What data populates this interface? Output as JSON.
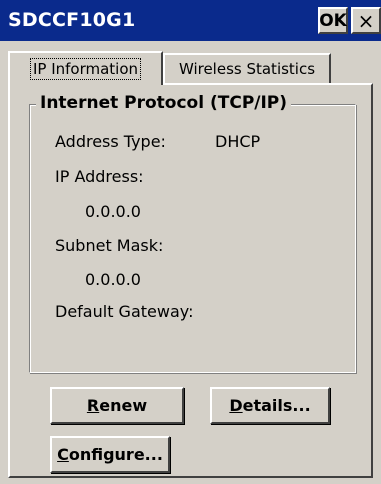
{
  "window": {
    "title": "SDCCF10G1",
    "ok_label": "OK",
    "close_label": "×"
  },
  "tabs": [
    {
      "label": "IP Information",
      "active": true
    },
    {
      "label": "Wireless Statistics",
      "active": false
    }
  ],
  "group": {
    "title": "Internet Protocol (TCP/IP)",
    "address_type_label": "Address Type:",
    "address_type_value": "DHCP",
    "ip_address_label": "IP Address:",
    "ip_address_value": "0.0.0.0",
    "subnet_mask_label": "Subnet Mask:",
    "subnet_mask_value": "0.0.0.0",
    "default_gateway_label": "Default Gateway:",
    "default_gateway_value": ""
  },
  "buttons": {
    "renew": {
      "mnemonic": "R",
      "rest": "enew"
    },
    "details": {
      "mnemonic": "D",
      "rest": "etails..."
    },
    "configure": {
      "mnemonic": "C",
      "rest": "onfigure..."
    }
  }
}
